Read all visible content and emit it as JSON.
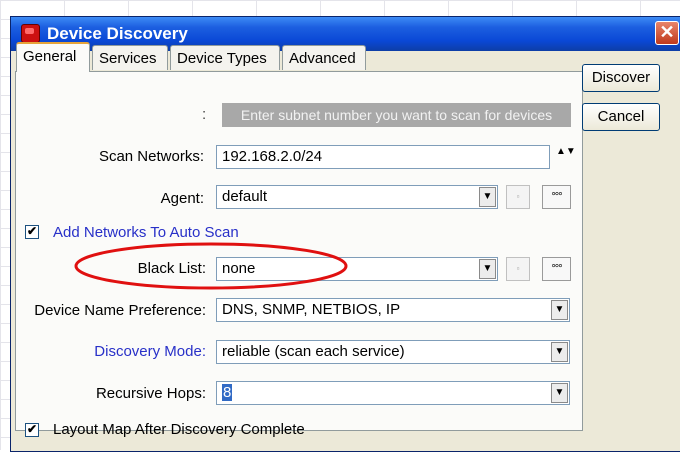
{
  "window": {
    "title": "Device Discovery",
    "close_label": "✕"
  },
  "tabs": [
    {
      "label": "General",
      "active": true
    },
    {
      "label": "Services",
      "active": false
    },
    {
      "label": "Device Types",
      "active": false
    },
    {
      "label": "Advanced",
      "active": false
    }
  ],
  "buttons": {
    "discover": "Discover",
    "cancel": "Cancel"
  },
  "form": {
    "hint_colon": ":",
    "hint": "Enter subnet number you want to scan for devices",
    "scan_networks": {
      "label": "Scan Networks:",
      "value": "192.168.2.0/24"
    },
    "agent": {
      "label": "Agent:",
      "value": "default"
    },
    "add_networks": {
      "label": "Add Networks To Auto Scan",
      "checked": true
    },
    "black_list": {
      "label": "Black List:",
      "value": "none"
    },
    "name_pref": {
      "label": "Device Name Preference:",
      "value": "DNS, SNMP, NETBIOS, IP"
    },
    "discovery_mode": {
      "label": "Discovery Mode:",
      "value": "reliable (scan each service)"
    },
    "recursive_hops": {
      "label": "Recursive Hops:",
      "value": "8"
    },
    "layout_map": {
      "label": "Layout Map After Discovery Complete",
      "checked": true
    }
  },
  "icons": {
    "checkmark": "✔",
    "dropdown": "▼",
    "spin": "▲▼",
    "dots": "°°°",
    "small": "▫"
  },
  "colors": {
    "title_bar": "#0a48d6",
    "annotation": "#e01010",
    "link_label": "#2830c8"
  }
}
